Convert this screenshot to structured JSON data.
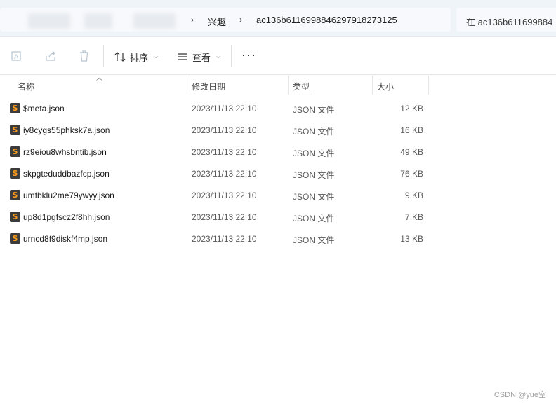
{
  "address": {
    "crumbs": [
      "兴趣",
      "ac136b6116998846297918273125"
    ],
    "search_placeholder": "在 ac136b611699884"
  },
  "toolbar": {
    "sort_label": "排序",
    "view_label": "查看",
    "more_label": "···"
  },
  "columns": {
    "name": "名称",
    "date": "修改日期",
    "type": "类型",
    "size": "大小"
  },
  "files": [
    {
      "name": "$meta.json",
      "date": "2023/11/13 22:10",
      "type": "JSON 文件",
      "size": "12 KB"
    },
    {
      "name": "iy8cygs55phksk7a.json",
      "date": "2023/11/13 22:10",
      "type": "JSON 文件",
      "size": "16 KB"
    },
    {
      "name": "rz9eiou8whsbntib.json",
      "date": "2023/11/13 22:10",
      "type": "JSON 文件",
      "size": "49 KB"
    },
    {
      "name": "skpgteduddbazfcp.json",
      "date": "2023/11/13 22:10",
      "type": "JSON 文件",
      "size": "76 KB"
    },
    {
      "name": "umfbklu2me79ywyy.json",
      "date": "2023/11/13 22:10",
      "type": "JSON 文件",
      "size": "9 KB"
    },
    {
      "name": "up8d1pgfscz2f8hh.json",
      "date": "2023/11/13 22:10",
      "type": "JSON 文件",
      "size": "7 KB"
    },
    {
      "name": "urncd8f9diskf4mp.json",
      "date": "2023/11/13 22:10",
      "type": "JSON 文件",
      "size": "13 KB"
    }
  ],
  "file_icon_glyph": "S",
  "watermark": "CSDN @yue空",
  "colors": {
    "accent_icon": "#ff9d1a",
    "header_bg": "#eff4f9"
  }
}
